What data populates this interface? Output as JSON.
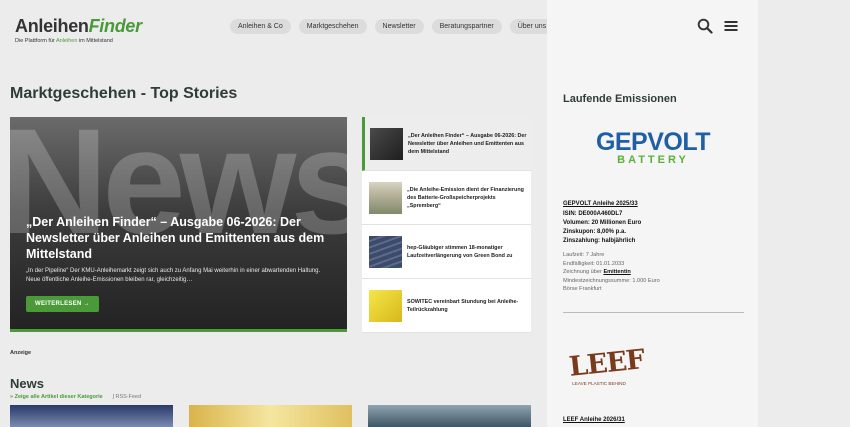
{
  "header": {
    "logo_main_1": "Anleihen",
    "logo_main_2": "Finder",
    "logo_sub_1": "Die Plattform für ",
    "logo_sub_2": "Anleihen",
    "logo_sub_3": " im Mittelstand",
    "nav": [
      "Anleihen & Co",
      "Marktgeschehen",
      "Newsletter",
      "Beratungspartner",
      "Über uns"
    ],
    "icons": [
      "search-icon",
      "menu-icon"
    ]
  },
  "main": {
    "section_title": "Marktgeschehen - Top Stories",
    "hero": {
      "bg_word": "News",
      "title": "„Der Anleihen Finder“ – Ausgabe 06-2026: Der Newsletter über Anleihen und Emittenten aus dem Mittelstand",
      "excerpt": "„In der Pipeline“ Der KMU-Anleihemarkt zeigt sich auch zu Anfang Mai weiterhin in einer abwartenden Haltung. Neue öffentliche Anleihe-Emissionen bleiben rar, gleichzeitig…",
      "button": "WEITERLESEN →"
    },
    "stories": [
      {
        "title": "„Der Anleihen Finder“ – Ausgabe 06-2026: Der Newsletter über Anleihen und Emittenten aus dem Mittelstand"
      },
      {
        "title": "„Die Anleihe-Emission dient der Finanzierung des Batterie-Großspeicherprojekts „Spremberg“"
      },
      {
        "title": "hep-Gläubiger stimmen 18-monatiger Laufzeitverlängerung von Green Bond zu"
      },
      {
        "title": "SOWITEC vereinbart Stundung bei Anleihe-Teilrückzahlung"
      }
    ],
    "anzeige": "Anzeige",
    "news_title": "News",
    "news_link_all": "» Zeige alle Artikel dieser Kategorie",
    "news_link_rss": "RSS-Feed"
  },
  "aside": {
    "title": "Laufende Emissionen",
    "gepvolt": {
      "logo_1": "GEPVOLT",
      "logo_2": "BATTERY",
      "name": "GEPVOLT Anleihe 2025/33",
      "facts": [
        "ISIN: DE000A460DL7",
        "Volumen: 20 Millionen Euro",
        "Zinskupon: 8,00% p.a.",
        "Zinszahlung: halbjährlich"
      ],
      "meta": [
        "Laufzeit: 7 Jahre",
        "Endfälligkeit: 01.01.2033"
      ],
      "zeichnung_pre": "Zeichnung über ",
      "zeichnung_link": "Emittentin",
      "meta2": [
        "Mindestzeichnungssumme: 1.000 Euro",
        "Börse Frankfurt"
      ]
    },
    "leef": {
      "logo_1": "LEEF",
      "logo_2": "LEAVE PLASTIC BEHIND",
      "name": "LEEF Anleihe 2026/31"
    }
  },
  "colors": {
    "accent": "#4a9a3a",
    "gepvolt_blue": "#1f5fa6",
    "leef_brown": "#7a3a1c"
  }
}
